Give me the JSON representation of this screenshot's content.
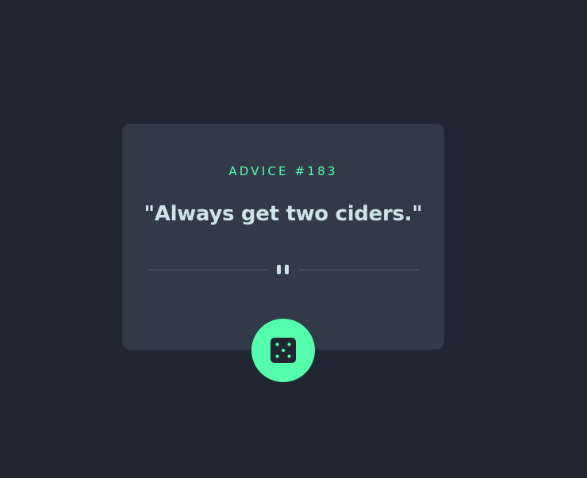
{
  "advice": {
    "id_label": "ADVICE #183",
    "quote": "\"Always get two ciders.\""
  },
  "icons": {
    "divider": "pause-icon",
    "button": "dice-icon"
  },
  "colors": {
    "background": "#202632",
    "card": "#323a49",
    "accent": "#53ffab",
    "text": "#cee3e9",
    "divider": "#4f5d74"
  }
}
